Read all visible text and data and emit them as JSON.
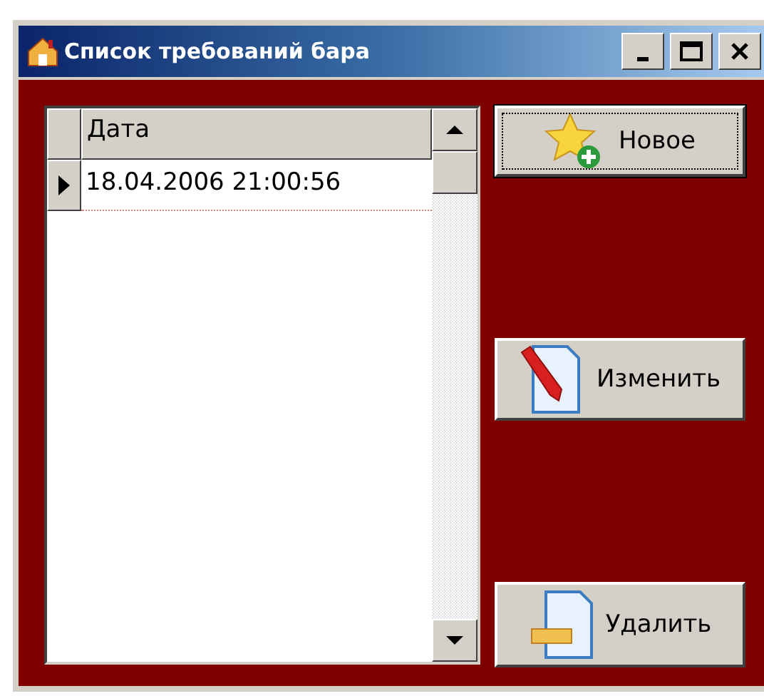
{
  "window": {
    "title": "Список требований бара"
  },
  "grid": {
    "columns": [
      "Дата"
    ],
    "rows": [
      {
        "cells": [
          "18.04.2006 21:00:56"
        ],
        "selected": true
      }
    ]
  },
  "buttons": [
    {
      "label": "Новое",
      "kind": "new",
      "focused": true
    },
    {
      "label": "Изменить",
      "kind": "edit",
      "focused": false
    },
    {
      "label": "Удалить",
      "kind": "delete",
      "focused": false
    }
  ]
}
